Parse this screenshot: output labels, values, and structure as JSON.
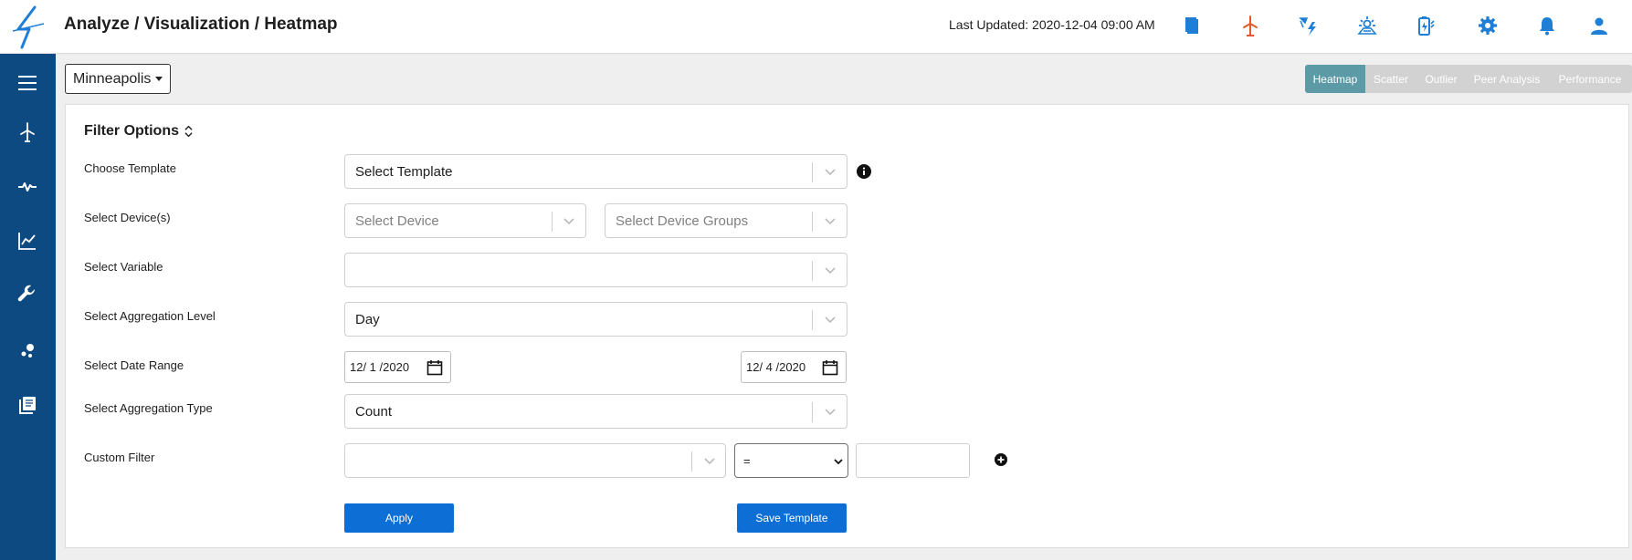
{
  "header": {
    "breadcrumb": "Analyze / Visualization / Heatmap",
    "last_updated": "Last Updated: 2020-12-04 09:00 AM",
    "icons": [
      "book-icon",
      "wind-turbine-icon",
      "wind-power-icon",
      "solar-icon",
      "battery-icon",
      "settings-icon",
      "bell-icon",
      "user-icon"
    ]
  },
  "sidebar": {
    "items": [
      "menu-icon",
      "wind-turbine-icon",
      "pulse-icon",
      "chart-icon",
      "wrench-icon",
      "scatter-icon",
      "library-icon"
    ]
  },
  "location": {
    "label": "Minneapolis"
  },
  "tabs": [
    {
      "label": "Heatmap",
      "active": true
    },
    {
      "label": "Scatter",
      "active": false
    },
    {
      "label": "Outlier",
      "active": false
    },
    {
      "label": "Peer Analysis",
      "active": false
    },
    {
      "label": "Performance",
      "active": false
    }
  ],
  "filter": {
    "title": "Filter Options",
    "labels": {
      "template": "Choose Template",
      "devices": "Select Device(s)",
      "variable": "Select Variable",
      "aggregation_level": "Select Aggregation Level",
      "date_range": "Select Date Range",
      "aggregation_type": "Select Aggregation Type",
      "custom_filter": "Custom Filter"
    },
    "template_placeholder": "Select Template",
    "device_placeholder": "Select Device",
    "device_groups_placeholder": "Select Device Groups",
    "variable_value": "",
    "aggregation_level_value": "Day",
    "date_start": "12/ 1 /2020",
    "date_end": "12/ 4 /2020",
    "aggregation_type_value": "Count",
    "operator_value": "=",
    "apply_label": "Apply",
    "save_template_label": "Save Template"
  },
  "colors": {
    "sidebar": "#0e4a82",
    "accent": "#0d6fd6",
    "tab_active": "#5c9aa5",
    "tab_inactive": "#d2d2d2",
    "icon_blue": "#1f7fd6",
    "icon_orange": "#e8572a"
  }
}
